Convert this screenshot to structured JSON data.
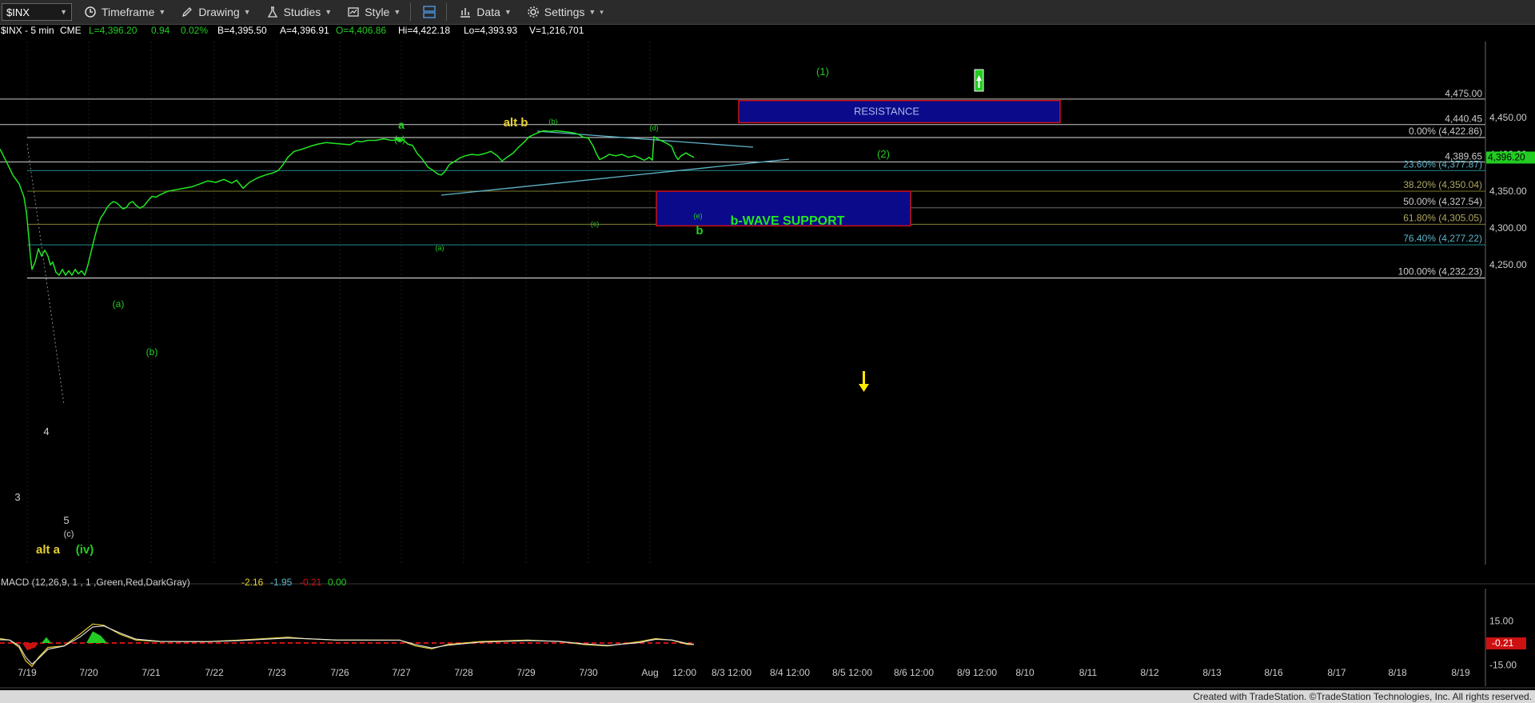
{
  "toolbar": {
    "symbol": "$INX",
    "items": [
      "Timeframe",
      "Drawing",
      "Studies",
      "Style",
      "Data",
      "Settings"
    ]
  },
  "header": {
    "symbol_interval": "$INX - 5 min",
    "exchange": "CME",
    "last": "L=4,396.20",
    "change": "0.94",
    "change_pct": "0.02%",
    "bid": "B=4,395.50",
    "ask": "A=4,396.91",
    "open": "O=4,406.86",
    "high": "Hi=4,422.18",
    "low": "Lo=4,393.93",
    "volume": "V=1,216,701"
  },
  "colors": {
    "price": "#22e622",
    "wave_label": "#22cc22",
    "alt_label": "#e8d030",
    "box_fill": "#0a0a8a",
    "box_border": "#cc1111",
    "last_price_bg": "#22cc22",
    "macd_neg_bg": "#cc1111",
    "trendline": "#5fb4c8"
  },
  "chart_data": {
    "type": "line",
    "title": "$INX - 5 min",
    "ylim": [
      4205,
      4490
    ],
    "x_ticks": [
      "7/19",
      "7/20",
      "7/21",
      "7/22",
      "7/23",
      "7/26",
      "7/27",
      "7/28",
      "7/29",
      "7/30",
      "Aug",
      "12:00",
      "8/3 12:00",
      "8/4 12:00",
      "8/5 12:00",
      "8/6 12:00",
      "8/9 12:00",
      "8/10",
      "8/11",
      "8/12",
      "8/13",
      "8/16",
      "8/17",
      "8/18",
      "8/19"
    ],
    "y_ticks": [
      {
        "value": 4450,
        "label": "4,450.00"
      },
      {
        "value": 4400,
        "label": "4,400.00"
      },
      {
        "value": 4350,
        "label": "4,350.00"
      },
      {
        "value": 4300,
        "label": "4,300.00"
      },
      {
        "value": 4250,
        "label": "4,250.00"
      }
    ],
    "last_price": {
      "value": 4396.2,
      "label": "4,396.20"
    },
    "price_series": {
      "name": "$INX",
      "points": [
        [
          0,
          4407
        ],
        [
          8,
          4390
        ],
        [
          16,
          4372
        ],
        [
          24,
          4360
        ],
        [
          30,
          4342
        ],
        [
          33,
          4322
        ],
        [
          36,
          4288
        ],
        [
          38,
          4262
        ],
        [
          40,
          4244
        ],
        [
          44,
          4254
        ],
        [
          48,
          4272
        ],
        [
          52,
          4262
        ],
        [
          56,
          4270
        ],
        [
          60,
          4262
        ],
        [
          63,
          4250
        ],
        [
          66,
          4254
        ],
        [
          70,
          4240
        ],
        [
          74,
          4236
        ],
        [
          78,
          4244
        ],
        [
          82,
          4236
        ],
        [
          86,
          4242
        ],
        [
          90,
          4236
        ],
        [
          94,
          4244
        ],
        [
          98,
          4238
        ],
        [
          102,
          4242
        ],
        [
          106,
          4236
        ],
        [
          110,
          4250
        ],
        [
          114,
          4268
        ],
        [
          118,
          4286
        ],
        [
          122,
          4302
        ],
        [
          126,
          4314
        ],
        [
          130,
          4320
        ],
        [
          134,
          4328
        ],
        [
          138,
          4333
        ],
        [
          142,
          4336
        ],
        [
          146,
          4334
        ],
        [
          150,
          4330
        ],
        [
          154,
          4326
        ],
        [
          158,
          4328
        ],
        [
          162,
          4334
        ],
        [
          166,
          4336
        ],
        [
          170,
          4331
        ],
        [
          175,
          4327
        ],
        [
          180,
          4330
        ],
        [
          185,
          4337
        ],
        [
          190,
          4343
        ],
        [
          195,
          4342
        ],
        [
          200,
          4345
        ],
        [
          210,
          4350
        ],
        [
          220,
          4352
        ],
        [
          230,
          4354
        ],
        [
          240,
          4356
        ],
        [
          250,
          4360
        ],
        [
          260,
          4364
        ],
        [
          270,
          4362
        ],
        [
          280,
          4366
        ],
        [
          290,
          4361
        ],
        [
          296,
          4365
        ],
        [
          304,
          4354
        ],
        [
          312,
          4362
        ],
        [
          322,
          4368
        ],
        [
          332,
          4372
        ],
        [
          342,
          4375
        ],
        [
          348,
          4378
        ],
        [
          354,
          4386
        ],
        [
          360,
          4396
        ],
        [
          368,
          4404
        ],
        [
          378,
          4407
        ],
        [
          388,
          4411
        ],
        [
          398,
          4414
        ],
        [
          408,
          4416
        ],
        [
          418,
          4415
        ],
        [
          428,
          4414
        ],
        [
          438,
          4413
        ],
        [
          446,
          4418
        ],
        [
          452,
          4417
        ],
        [
          460,
          4419
        ],
        [
          470,
          4419
        ],
        [
          480,
          4421
        ],
        [
          490,
          4419
        ],
        [
          500,
          4420
        ],
        [
          504,
          4419
        ],
        [
          498,
          4418
        ],
        [
          494,
          4422
        ],
        [
          498,
          4421
        ],
        [
          502,
          4422
        ],
        [
          506,
          4418
        ],
        [
          510,
          4414
        ],
        [
          516,
          4412
        ],
        [
          522,
          4401
        ],
        [
          528,
          4394
        ],
        [
          535,
          4383
        ],
        [
          542,
          4378
        ],
        [
          548,
          4373
        ],
        [
          552,
          4372
        ],
        [
          556,
          4376
        ],
        [
          562,
          4386
        ],
        [
          568,
          4390
        ],
        [
          575,
          4395
        ],
        [
          582,
          4398
        ],
        [
          590,
          4400
        ],
        [
          598,
          4399
        ],
        [
          606,
          4401
        ],
        [
          614,
          4404
        ],
        [
          622,
          4398
        ],
        [
          628,
          4391
        ],
        [
          634,
          4396
        ],
        [
          642,
          4402
        ],
        [
          648,
          4409
        ],
        [
          656,
          4417
        ],
        [
          662,
          4424
        ],
        [
          668,
          4427
        ],
        [
          674,
          4430
        ],
        [
          680,
          4432
        ],
        [
          688,
          4431
        ],
        [
          696,
          4432
        ],
        [
          704,
          4431
        ],
        [
          712,
          4430
        ],
        [
          718,
          4429
        ],
        [
          724,
          4427
        ],
        [
          730,
          4423
        ],
        [
          736,
          4422
        ],
        [
          742,
          4411
        ],
        [
          746,
          4401
        ],
        [
          750,
          4393
        ],
        [
          756,
          4396
        ],
        [
          762,
          4400
        ],
        [
          770,
          4398
        ],
        [
          778,
          4400
        ],
        [
          786,
          4396
        ],
        [
          794,
          4398
        ],
        [
          800,
          4395
        ],
        [
          806,
          4392
        ],
        [
          812,
          4396
        ],
        [
          816,
          4392
        ],
        [
          818,
          4424
        ],
        [
          822,
          4421
        ],
        [
          828,
          4418
        ],
        [
          834,
          4415
        ],
        [
          840,
          4411
        ],
        [
          844,
          4400
        ],
        [
          848,
          4393
        ],
        [
          852,
          4398
        ],
        [
          858,
          4402
        ],
        [
          864,
          4398
        ],
        [
          868,
          4396
        ]
      ]
    },
    "fib_levels": [
      {
        "label": "0.00% (4,422.86)",
        "value": 4422.86
      },
      {
        "label": "23.60% (4,377.87)",
        "value": 4377.87
      },
      {
        "label": "38.20% (4,350.04)",
        "value": 4350.04
      },
      {
        "label": "50.00% (4,327.54)",
        "value": 4327.54
      },
      {
        "label": "61.80% (4,305.05)",
        "value": 4305.05
      },
      {
        "label": "76.40% (4,277.22)",
        "value": 4277.22
      },
      {
        "label": "100.00% (4,232.23)",
        "value": 4232.23
      }
    ],
    "horizontal_levels": [
      {
        "label": "4,475.00",
        "value": 4475.0
      },
      {
        "label": "4,440.45",
        "value": 4440.45
      },
      {
        "label": "4,389.65",
        "value": 4389.65
      }
    ],
    "zones": [
      {
        "label": "RESISTANCE",
        "y_low": 4443,
        "y_high": 4473
      },
      {
        "label": "b-WAVE SUPPORT",
        "y_low": 4303,
        "y_high": 4350
      }
    ],
    "wave_labels": [
      "3",
      "4",
      "5",
      "(c)",
      "alt a",
      "(iv)",
      "(a)",
      "(b)",
      "a",
      "(c)",
      "alt b",
      "(b)",
      "(a)",
      "(c)",
      "(d)",
      "(e)",
      "b",
      "(1)",
      "(2)"
    ],
    "macd": {
      "title": "MACD (12,26,9, 1 , 1 ,Green,Red,DarkGray)",
      "values": [
        "-2.16",
        "-1.95",
        "-0.21",
        "0.00"
      ],
      "y_ticks": [
        {
          "value": 15,
          "label": "15.00"
        },
        {
          "value": -15,
          "label": "-15.00"
        }
      ],
      "last_hist_label": "-0.21",
      "ylim": [
        -20,
        20
      ]
    }
  },
  "footer": {
    "credit": "Created with TradeStation. ©TradeStation Technologies, Inc. All rights reserved."
  }
}
